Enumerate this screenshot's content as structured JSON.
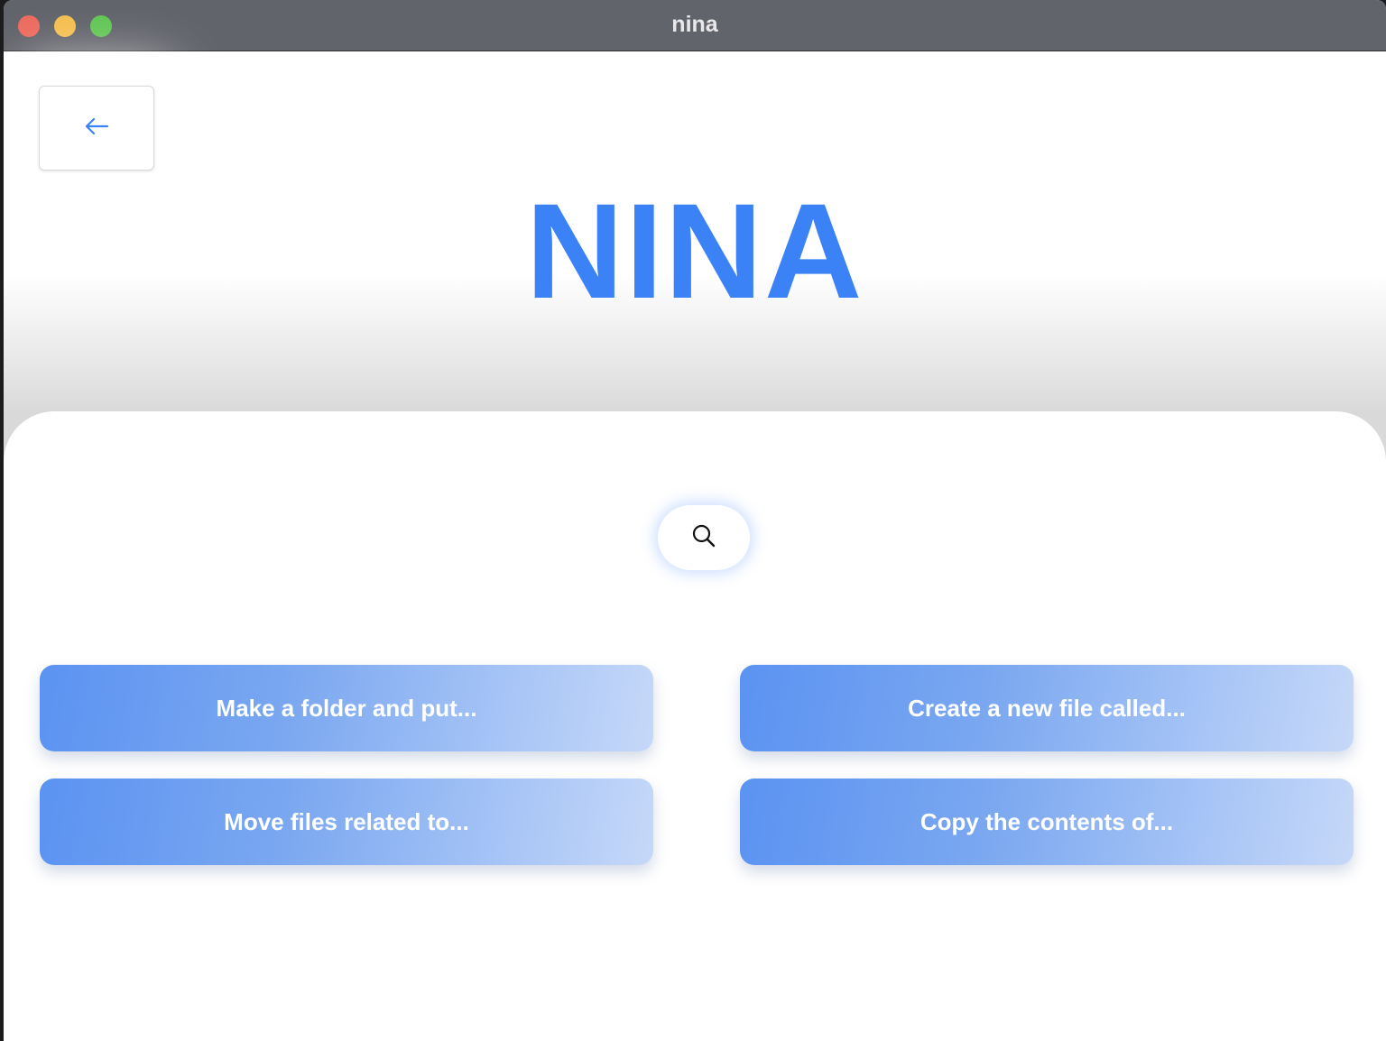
{
  "window": {
    "title": "nina"
  },
  "header": {
    "back_icon": "arrow-left-icon",
    "logo_text": "NINA",
    "accent_color": "#3b82f6"
  },
  "search": {
    "icon": "search-icon"
  },
  "actions": [
    {
      "label": "Make a folder and put..."
    },
    {
      "label": "Create a new file called..."
    },
    {
      "label": "Move files related to..."
    },
    {
      "label": "Copy the contents of..."
    }
  ]
}
